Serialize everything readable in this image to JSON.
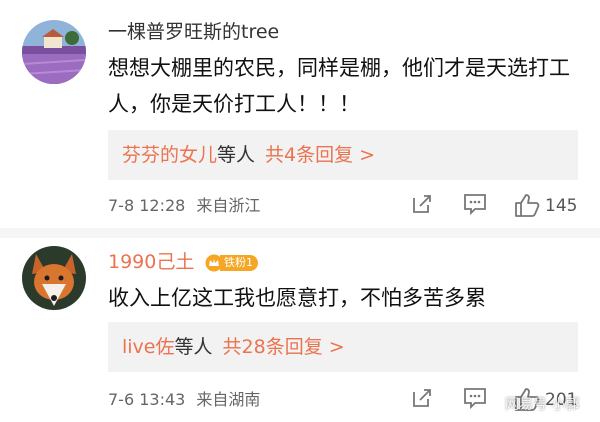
{
  "comments": [
    {
      "username": "一棵普罗旺斯的tree",
      "content": "想想大棚里的农民，同样是棚，他们才是天选打工人，你是天价打工人！！！",
      "replies": {
        "names": "芬芬的女儿",
        "suffix": "等人",
        "count": "共4条回复 >"
      },
      "time": "7-8 12:28",
      "source": "来自浙江",
      "likes": "145",
      "avatar_icon": "lavender-field-avatar"
    },
    {
      "username": "1990己土",
      "badge": "铁粉1",
      "content": "收入上亿这工我也愿意打，不怕多苦多累",
      "replies": {
        "names": "live佐",
        "suffix": "等人",
        "count": "共28条回复 >"
      },
      "time": "7-6 13:43",
      "source": "来自湖南",
      "likes": "201",
      "avatar_icon": "fox-avatar"
    }
  ],
  "watermark": "网易号 小郭",
  "colors": {
    "accent": "#eb7350",
    "badge": "#f5a623",
    "reply_bg": "#f2f2f2"
  }
}
